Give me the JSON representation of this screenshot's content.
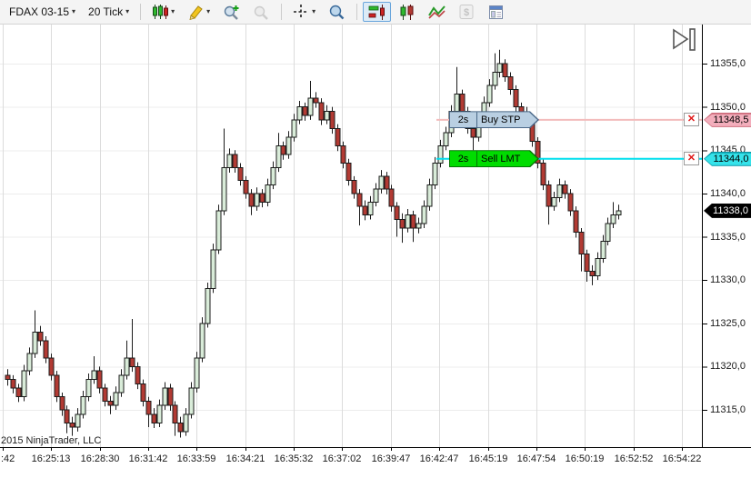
{
  "toolbar": {
    "instrument_label": "FDAX 03-15",
    "interval_label": "20 Tick",
    "icons": [
      "chevron-down-icon",
      "candlestick-style-icon",
      "pencil-icon",
      "zoom-in-icon",
      "zoom-out-icon",
      "crosshair-icon",
      "data-box-icon",
      "chart-trader-icon",
      "bars-panel-icon",
      "line-chart-icon",
      "dollar-icon",
      "properties-icon",
      "scroll-to-end-icon"
    ]
  },
  "footer": {
    "copyright": "2015 NinjaTrader, LLC"
  },
  "chart_data": {
    "type": "candlestick",
    "title": "FDAX 03-15 (20 Tick)",
    "x_axis": {
      "tick_labels": [
        ":42",
        "16:25:13",
        "16:28:30",
        "16:31:42",
        "16:33:59",
        "16:34:21",
        "16:35:32",
        "16:37:02",
        "16:39:47",
        "16:42:47",
        "16:45:19",
        "16:47:54",
        "16:50:19",
        "16:52:52",
        "16:54:22"
      ]
    },
    "y_axis": {
      "tick_values": [
        11355,
        11350,
        11345,
        11340,
        11335,
        11330,
        11325,
        11320,
        11315
      ],
      "tick_labels": [
        "11355,0",
        "11350,0",
        "11345,0",
        "11340,0",
        "11335,0",
        "11330,0",
        "11325,0",
        "11320,0",
        "11315,0"
      ],
      "range": [
        11311.5,
        11357.5
      ]
    },
    "colors": {
      "up_fill": "#d9ecd9",
      "down_fill": "#b23a33",
      "outline": "#1c1c1c",
      "grid_vertical": "#dcdcdc",
      "grid_horizontal": "#ececec",
      "axis_line": "#000000"
    },
    "orders": [
      {
        "name": "buy-stop-order",
        "duration": "2s",
        "label": "Buy STP",
        "price": 11348.5,
        "price_label": "11348,5",
        "line_color": "#f3bcbc",
        "label_fill": "#b9cfe2",
        "label_border": "#4a6888",
        "tag_fill": "#f3aebc",
        "tag_border": "#cf6f7e"
      },
      {
        "name": "sell-limit-order",
        "duration": "2s",
        "label": "Sell LMT",
        "price": 11344.0,
        "price_label": "11344,0",
        "line_color": "#00dfee",
        "label_fill": "#00dc00",
        "label_border": "#067406",
        "tag_fill": "#35e3ea",
        "tag_border": "#0a99a8"
      }
    ],
    "last_price": 11338.0,
    "last_price_label": "11338,0",
    "last_price_tag": {
      "fill": "#000000",
      "text_color": "#ffffff"
    },
    "candles_ohlc": [
      [
        11319.0,
        11319.7,
        11317.8,
        11318.5
      ],
      [
        11318.5,
        11319.0,
        11316.9,
        11317.5
      ],
      [
        11317.5,
        11318.0,
        11315.9,
        11316.5
      ],
      [
        11316.5,
        11320.2,
        11316.0,
        11319.5
      ],
      [
        11319.5,
        11322.2,
        11319.0,
        11321.5
      ],
      [
        11321.5,
        11326.5,
        11321.0,
        11324.0
      ],
      [
        11324.0,
        11324.7,
        11322.4,
        11323.0
      ],
      [
        11323.0,
        11323.5,
        11320.4,
        11321.0
      ],
      [
        11321.0,
        11321.5,
        11318.4,
        11319.0
      ],
      [
        11319.0,
        11319.5,
        11315.9,
        11316.5
      ],
      [
        11316.5,
        11317.0,
        11314.3,
        11315.0
      ],
      [
        11315.0,
        11315.5,
        11312.3,
        11313.5
      ],
      [
        11313.5,
        11314.2,
        11312.0,
        11313.0
      ],
      [
        11313.0,
        11315.2,
        11312.5,
        11314.5
      ],
      [
        11314.5,
        11317.2,
        11314.0,
        11316.5
      ],
      [
        11316.5,
        11319.2,
        11316.0,
        11318.5
      ],
      [
        11318.5,
        11321.2,
        11318.0,
        11319.5
      ],
      [
        11319.5,
        11320.0,
        11316.9,
        11317.5
      ],
      [
        11317.5,
        11318.0,
        11315.4,
        11316.0
      ],
      [
        11316.0,
        11316.6,
        11314.5,
        11315.5
      ],
      [
        11315.5,
        11317.7,
        11315.0,
        11317.0
      ],
      [
        11317.0,
        11319.7,
        11316.5,
        11319.0
      ],
      [
        11319.0,
        11323.0,
        11318.5,
        11321.0
      ],
      [
        11321.0,
        11325.5,
        11319.4,
        11320.0
      ],
      [
        11320.0,
        11320.5,
        11317.4,
        11318.0
      ],
      [
        11318.0,
        11318.5,
        11315.4,
        11316.0
      ],
      [
        11316.0,
        11316.5,
        11313.0,
        11314.5
      ],
      [
        11314.5,
        11315.2,
        11312.9,
        11313.5
      ],
      [
        11313.5,
        11316.2,
        11313.0,
        11315.5
      ],
      [
        11315.5,
        11318.2,
        11315.0,
        11317.5
      ],
      [
        11317.5,
        11318.0,
        11314.9,
        11315.5
      ],
      [
        11315.5,
        11316.0,
        11312.0,
        11313.5
      ],
      [
        11313.5,
        11314.2,
        11311.8,
        11312.5
      ],
      [
        11312.5,
        11315.2,
        11312.0,
        11314.5
      ],
      [
        11314.5,
        11318.2,
        11314.0,
        11317.5
      ],
      [
        11317.5,
        11321.7,
        11317.0,
        11321.0
      ],
      [
        11321.0,
        11325.7,
        11320.5,
        11325.0
      ],
      [
        11325.0,
        11329.7,
        11324.5,
        11329.0
      ],
      [
        11329.0,
        11334.2,
        11328.5,
        11333.5
      ],
      [
        11333.5,
        11338.7,
        11333.0,
        11338.0
      ],
      [
        11338.0,
        11347.5,
        11337.5,
        11343.0
      ],
      [
        11343.0,
        11345.2,
        11342.4,
        11344.5
      ],
      [
        11344.5,
        11345.0,
        11342.4,
        11343.0
      ],
      [
        11343.0,
        11343.5,
        11340.9,
        11341.5
      ],
      [
        11341.5,
        11342.0,
        11339.4,
        11340.0
      ],
      [
        11340.0,
        11340.5,
        11337.5,
        11338.5
      ],
      [
        11338.5,
        11340.7,
        11338.0,
        11340.0
      ],
      [
        11340.0,
        11340.5,
        11338.4,
        11339.0
      ],
      [
        11339.0,
        11341.7,
        11338.5,
        11341.0
      ],
      [
        11341.0,
        11343.7,
        11340.5,
        11343.0
      ],
      [
        11343.0,
        11347.0,
        11342.5,
        11345.5
      ],
      [
        11345.5,
        11346.0,
        11343.9,
        11344.5
      ],
      [
        11344.5,
        11347.2,
        11344.0,
        11346.5
      ],
      [
        11346.5,
        11349.2,
        11346.0,
        11348.5
      ],
      [
        11348.5,
        11350.7,
        11348.0,
        11350.0
      ],
      [
        11350.0,
        11350.5,
        11348.4,
        11349.0
      ],
      [
        11349.0,
        11353.0,
        11348.5,
        11351.0
      ],
      [
        11351.0,
        11351.7,
        11349.9,
        11350.5
      ],
      [
        11350.5,
        11351.0,
        11347.9,
        11348.5
      ],
      [
        11348.5,
        11350.2,
        11348.0,
        11349.5
      ],
      [
        11349.5,
        11350.0,
        11346.9,
        11347.5
      ],
      [
        11347.5,
        11348.0,
        11344.9,
        11345.5
      ],
      [
        11345.5,
        11346.0,
        11342.9,
        11343.5
      ],
      [
        11343.5,
        11344.0,
        11340.9,
        11341.5
      ],
      [
        11341.5,
        11342.0,
        11339.4,
        11340.0
      ],
      [
        11340.0,
        11340.5,
        11336.3,
        11338.5
      ],
      [
        11338.5,
        11339.2,
        11336.9,
        11337.5
      ],
      [
        11337.5,
        11339.7,
        11337.0,
        11339.0
      ],
      [
        11339.0,
        11341.2,
        11338.5,
        11340.5
      ],
      [
        11340.5,
        11342.7,
        11340.0,
        11342.0
      ],
      [
        11342.0,
        11342.5,
        11339.9,
        11340.5
      ],
      [
        11340.5,
        11341.0,
        11337.9,
        11338.5
      ],
      [
        11338.5,
        11339.0,
        11335.0,
        11337.0
      ],
      [
        11337.0,
        11337.7,
        11334.3,
        11336.0
      ],
      [
        11336.0,
        11338.2,
        11335.5,
        11337.5
      ],
      [
        11337.5,
        11338.0,
        11334.4,
        11336.0
      ],
      [
        11336.0,
        11337.2,
        11335.4,
        11336.5
      ],
      [
        11336.5,
        11339.2,
        11336.0,
        11338.5
      ],
      [
        11338.5,
        11341.7,
        11338.0,
        11341.0
      ],
      [
        11341.0,
        11344.2,
        11340.5,
        11343.5
      ],
      [
        11343.5,
        11346.2,
        11343.0,
        11345.5
      ],
      [
        11345.5,
        11347.7,
        11345.0,
        11347.0
      ],
      [
        11347.0,
        11350.2,
        11346.5,
        11349.5
      ],
      [
        11349.5,
        11354.6,
        11349.0,
        11351.5
      ],
      [
        11351.5,
        11352.0,
        11348.9,
        11349.5
      ],
      [
        11349.5,
        11350.0,
        11346.9,
        11347.5
      ],
      [
        11347.5,
        11348.0,
        11345.0,
        11346.5
      ],
      [
        11346.5,
        11349.2,
        11346.0,
        11348.5
      ],
      [
        11348.5,
        11351.2,
        11348.0,
        11350.5
      ],
      [
        11350.5,
        11353.2,
        11350.0,
        11352.5
      ],
      [
        11352.5,
        11356.2,
        11352.0,
        11354.0
      ],
      [
        11354.0,
        11356.6,
        11353.4,
        11355.0
      ],
      [
        11355.0,
        11355.5,
        11352.9,
        11353.5
      ],
      [
        11353.5,
        11354.0,
        11351.4,
        11352.0
      ],
      [
        11352.0,
        11352.5,
        11349.4,
        11350.0
      ],
      [
        11350.0,
        11350.5,
        11347.9,
        11348.5
      ],
      [
        11348.5,
        11350.0,
        11347.7,
        11348.5
      ],
      [
        11348.5,
        11349.0,
        11345.4,
        11346.0
      ],
      [
        11346.0,
        11346.5,
        11342.9,
        11343.5
      ],
      [
        11343.5,
        11344.0,
        11340.4,
        11341.0
      ],
      [
        11341.0,
        11341.5,
        11336.4,
        11338.5
      ],
      [
        11338.5,
        11340.2,
        11338.0,
        11339.5
      ],
      [
        11339.5,
        11341.7,
        11339.0,
        11341.0
      ],
      [
        11341.0,
        11341.5,
        11339.4,
        11340.0
      ],
      [
        11340.0,
        11340.5,
        11337.4,
        11338.0
      ],
      [
        11338.0,
        11338.5,
        11334.9,
        11335.5
      ],
      [
        11335.5,
        11336.0,
        11331.0,
        11333.0
      ],
      [
        11333.0,
        11333.5,
        11329.8,
        11331.0
      ],
      [
        11331.0,
        11331.7,
        11329.4,
        11330.5
      ],
      [
        11330.5,
        11333.2,
        11330.0,
        11332.5
      ],
      [
        11332.5,
        11335.2,
        11332.0,
        11334.5
      ],
      [
        11334.5,
        11337.2,
        11334.0,
        11336.5
      ],
      [
        11336.5,
        11339.0,
        11336.0,
        11337.5
      ],
      [
        11337.5,
        11338.7,
        11337.0,
        11338.0
      ]
    ]
  }
}
